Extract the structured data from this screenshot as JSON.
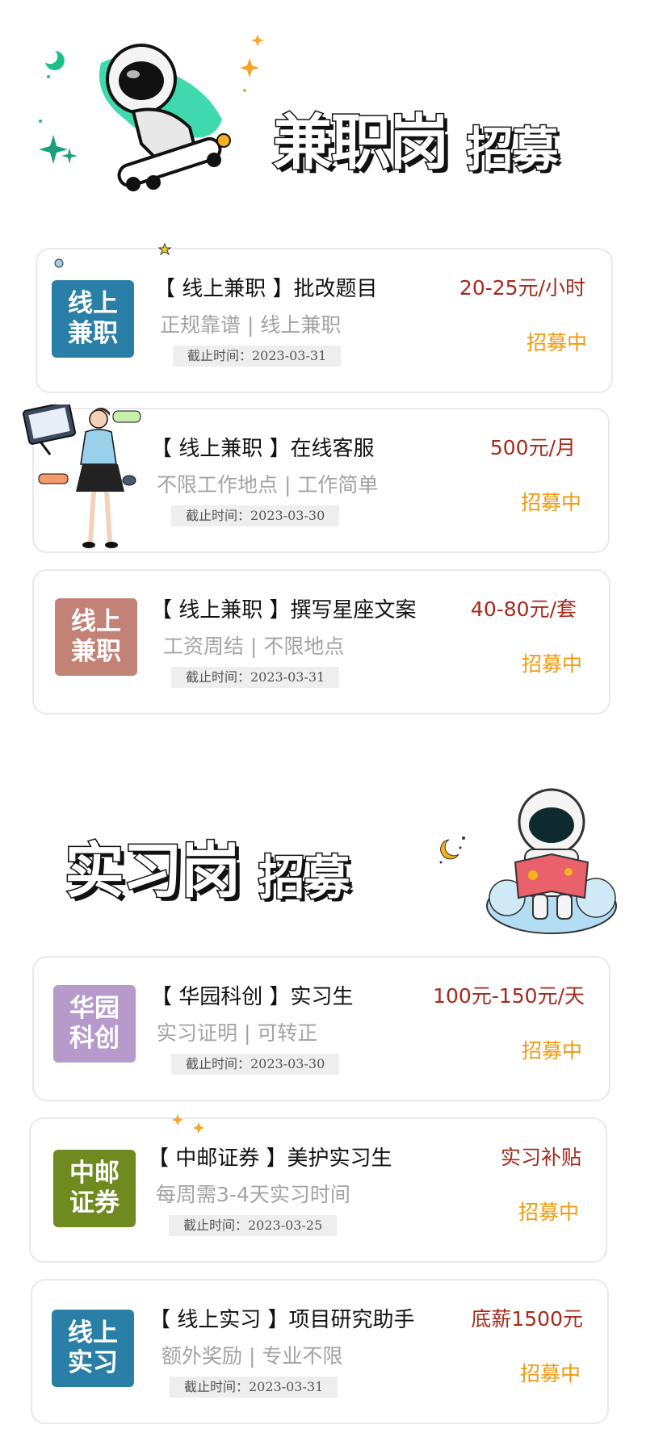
{
  "banners": {
    "parttime": {
      "title": "兼职岗",
      "sub": "招募"
    },
    "intern": {
      "title": "实习岗",
      "sub": "招募"
    }
  },
  "colors": {
    "salary": "#a52a1c",
    "status": "#f09a10",
    "badge_blue": "#2a7fa6",
    "badge_rose": "#c38276",
    "badge_purple": "#b59acb",
    "badge_olive": "#6f8a1f"
  },
  "parttime_jobs": [
    {
      "badge": [
        "线上",
        "兼职"
      ],
      "badge_color": "#2a7fa6",
      "title": "【 线上兼职 】批改题目",
      "desc": "正规靠谱 | 线上兼职",
      "deadline": "截止时间：2023-03-31",
      "salary": "20-25元/小时",
      "status": "招募中"
    },
    {
      "illustration": "office-woman-presenting",
      "title": "【 线上兼职 】在线客服",
      "desc": "不限工作地点 | 工作简单",
      "deadline": "截止时间：2023-03-30",
      "salary": "500元/月",
      "status": "招募中"
    },
    {
      "badge": [
        "线上",
        "兼职"
      ],
      "badge_color": "#c38276",
      "title": "【 线上兼职 】撰写星座文案",
      "desc": "工资周结 | 不限地点",
      "deadline": "截止时间：2023-03-31",
      "salary": "40-80元/套",
      "status": "招募中"
    }
  ],
  "intern_jobs": [
    {
      "badge": [
        "华园",
        "科创"
      ],
      "badge_color": "#b59acb",
      "title": "【 华园科创 】实习生",
      "desc": "实习证明 | 可转正",
      "deadline": "截止时间：2023-03-30",
      "salary": "100元-150元/天",
      "status": "招募中"
    },
    {
      "badge": [
        "中邮",
        "证券"
      ],
      "badge_color": "#6f8a1f",
      "title": "【 中邮证券 】美护实习生",
      "desc": "每周需3-4天实习时间",
      "deadline": "截止时间：2023-03-25",
      "salary": "实习补贴",
      "status": "招募中"
    },
    {
      "badge": [
        "线上",
        "实习"
      ],
      "badge_color": "#2a7fa6",
      "title": "【 线上实习 】项目研究助手",
      "desc": "额外奖励 | 专业不限",
      "deadline": "截止时间：2023-03-31",
      "salary": "底薪1500元",
      "status": "招募中"
    }
  ]
}
